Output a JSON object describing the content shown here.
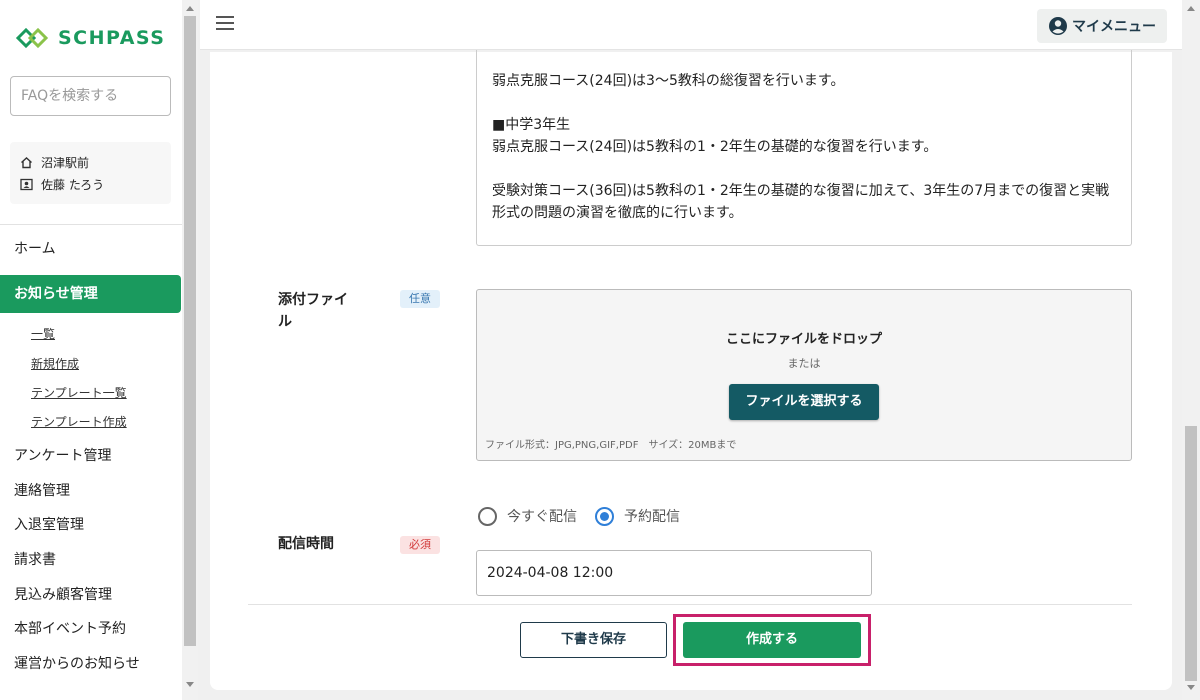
{
  "sidebar": {
    "logo_text": "SCHPASS",
    "search_placeholder": "FAQを検索する",
    "school": "沼津駅前",
    "user": "佐藤 たろう",
    "items": [
      {
        "label": "ホーム"
      },
      {
        "label": "お知らせ管理"
      },
      {
        "label": "アンケート管理"
      },
      {
        "label": "連絡管理"
      },
      {
        "label": "入退室管理"
      },
      {
        "label": "請求書"
      },
      {
        "label": "見込み顧客管理"
      },
      {
        "label": "本部イベント予約"
      },
      {
        "label": "運営からのお知らせ"
      }
    ],
    "sub_items": [
      {
        "label": "一覧"
      },
      {
        "label": "新規作成"
      },
      {
        "label": "テンプレート一覧"
      },
      {
        "label": "テンプレート作成"
      }
    ]
  },
  "header": {
    "my_menu": "マイメニュー"
  },
  "form": {
    "description_text": "弱点克服コース(24回)は3〜5教科の総復習を行います。\n\n■中学3年生\n弱点克服コース(24回)は5教科の1・2年生の基礎的な復習を行います。\n\n受験対策コース(36回)は5教科の1・2年生の基礎的な復習に加えて、3年生の7月までの復習と実戦形式の問題の演習を徹底的に行います。",
    "attachment": {
      "label": "添付ファイル",
      "badge": "任意",
      "drop_title": "ここにファイルをドロップ",
      "drop_or": "または",
      "select_button": "ファイルを選択する",
      "note": "ファイル形式：JPG,PNG,GIF,PDF　サイズ：20MBまで"
    },
    "delivery": {
      "label": "配信時間",
      "badge": "必須",
      "option_now": "今すぐ配信",
      "option_scheduled": "予約配信",
      "selected": "予約配信",
      "datetime_value": "2024-04-08 12:00"
    },
    "draft_button": "下書き保存",
    "create_button": "作成する"
  },
  "colors": {
    "brand_green": "#1a9a5e",
    "dark_teal": "#145a64",
    "highlight_border": "#c8206a"
  }
}
